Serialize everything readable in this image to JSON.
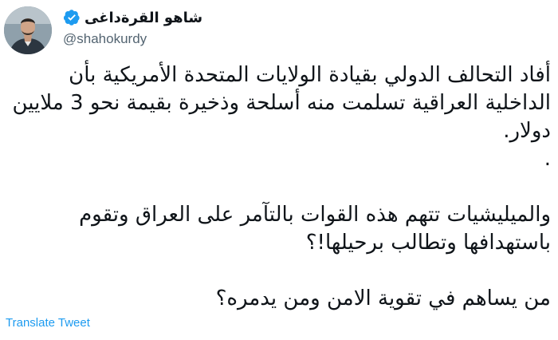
{
  "author": {
    "display_name": "شاهو القرةداغی",
    "handle": "@shahokurdy",
    "verified": true
  },
  "tweet": {
    "paragraphs": [
      "أفاد التحالف الدولي بقيادة الولايات المتحدة الأمريكية بأن الداخلية العراقية تسلمت منه أسلحة وذخيرة بقيمة نحو 3 ملايين دولار.",
      ".",
      "والميليشيات تتهم هذه القوات بالتآمر على العراق وتقوم باستهدافها وتطالب برحيلها!؟",
      "من يساهم في تقوية الامن ومن يدمره؟"
    ]
  },
  "actions": {
    "translate_label": "Translate Tweet"
  },
  "colors": {
    "accent": "#1d9bf0",
    "secondary_text": "#536471",
    "text": "#0f1419"
  },
  "icons": {
    "verified": "verified-badge-icon"
  }
}
